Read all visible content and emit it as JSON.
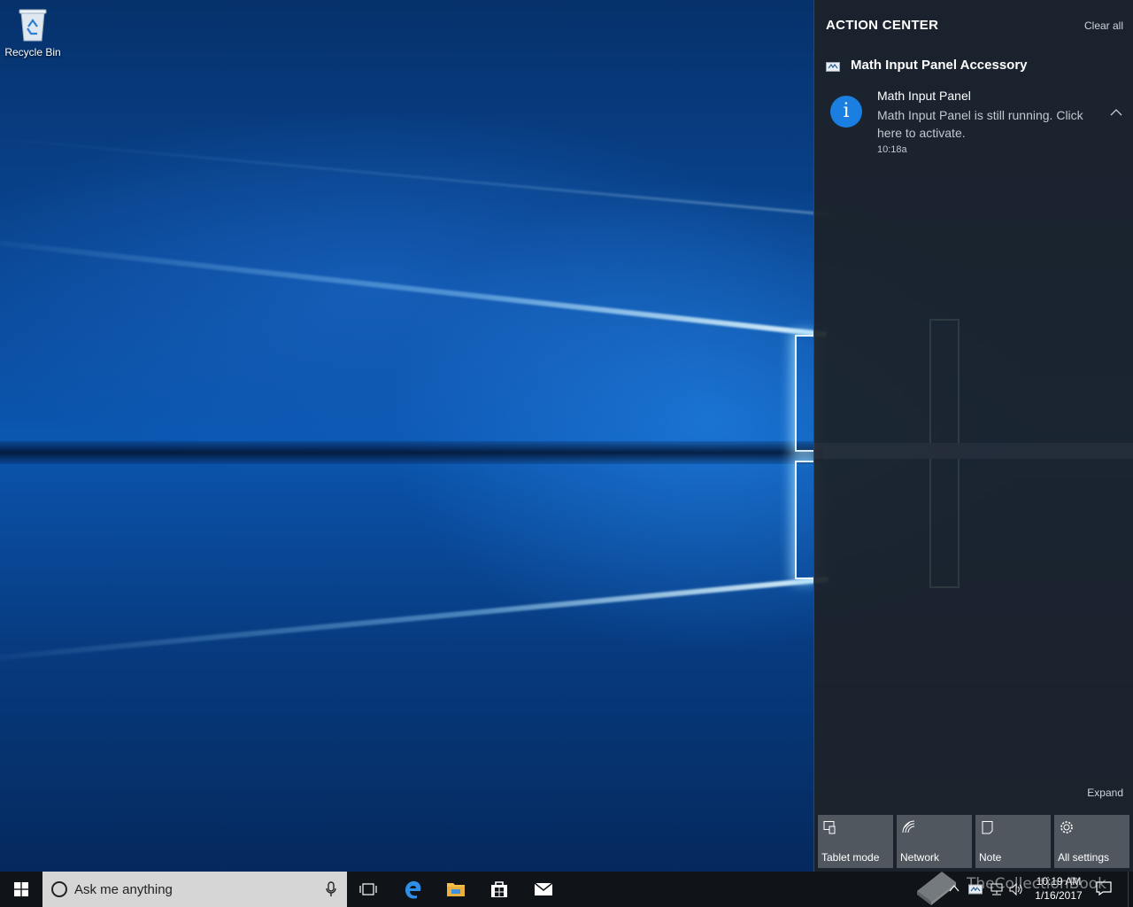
{
  "desktop": {
    "icons": [
      {
        "label": "Recycle Bin",
        "icon": "recycle-bin-icon"
      }
    ]
  },
  "action_center": {
    "title": "ACTION CENTER",
    "clear_all": "Clear all",
    "group": {
      "app": "Math Input Panel Accessory",
      "icon": "math-input-panel-icon"
    },
    "notification": {
      "title": "Math Input Panel",
      "body": "Math Input Panel is still running. Click here to activate.",
      "time": "10:18a",
      "icon": "info-icon",
      "accent": "#1a7fe0"
    },
    "expand": "Expand",
    "quick_actions": [
      {
        "label": "Tablet mode",
        "icon": "tablet-mode-icon"
      },
      {
        "label": "Network",
        "icon": "network-icon"
      },
      {
        "label": "Note",
        "icon": "note-icon"
      },
      {
        "label": "All settings",
        "icon": "gear-icon"
      }
    ]
  },
  "taskbar": {
    "search_placeholder": "Ask me anything",
    "pinned": [
      "task-view-icon",
      "edge-icon",
      "file-explorer-icon",
      "store-icon",
      "mail-icon"
    ],
    "clock": {
      "time": "10:19 AM",
      "date": "1/16/2017"
    },
    "watermark": "TheCollectionBook"
  },
  "colors": {
    "accent": "#1a7fe0",
    "action_center_bg": "#1c2128",
    "taskbar_bg": "#101418",
    "search_bg": "#d6d6d6"
  }
}
